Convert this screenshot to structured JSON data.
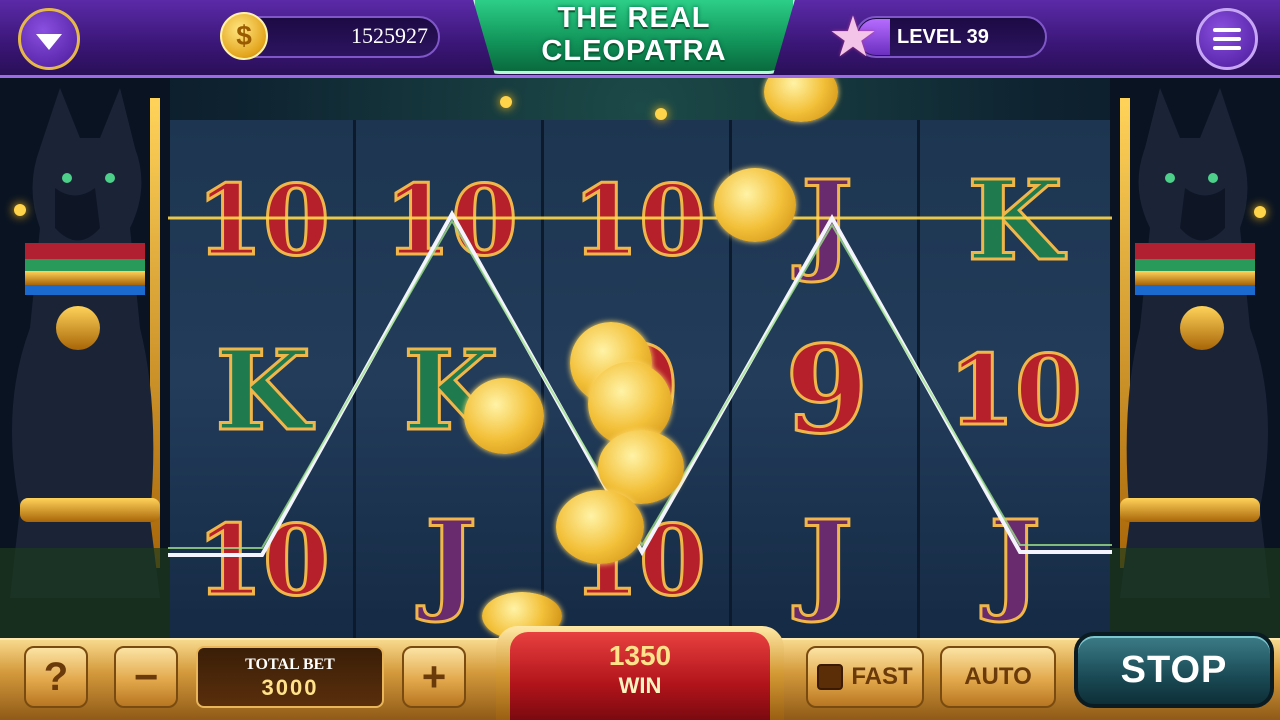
{
  "header": {
    "coin_balance": "1525927",
    "game_title_line1": "THE REAL",
    "game_title_line2": "CLEOPATRA",
    "level_label": "LEVEL 39",
    "colors": {
      "purple": "#4a1a99",
      "title_green": "#12955a"
    }
  },
  "icons": {
    "menu_dropdown": "chevron-down-icon",
    "coin": "dollar-coin-icon",
    "level_star": "star-icon",
    "main_menu": "hamburger-icon"
  },
  "reels": [
    {
      "symbols": [
        "10",
        "K",
        "10"
      ]
    },
    {
      "symbols": [
        "10",
        "K",
        "J"
      ]
    },
    {
      "symbols": [
        "10",
        "9",
        "10"
      ]
    },
    {
      "symbols": [
        "J",
        "9",
        "J"
      ]
    },
    {
      "symbols": [
        "K",
        "10",
        "J"
      ]
    }
  ],
  "controls": {
    "help_label": "?",
    "minus_label": "−",
    "plus_label": "+",
    "total_bet_label": "TOTAL BET",
    "total_bet_value": "3000",
    "win_value": "1350",
    "win_label": "WIN",
    "fast_label": "FAST",
    "auto_label": "AUTO",
    "stop_label": "STOP"
  }
}
